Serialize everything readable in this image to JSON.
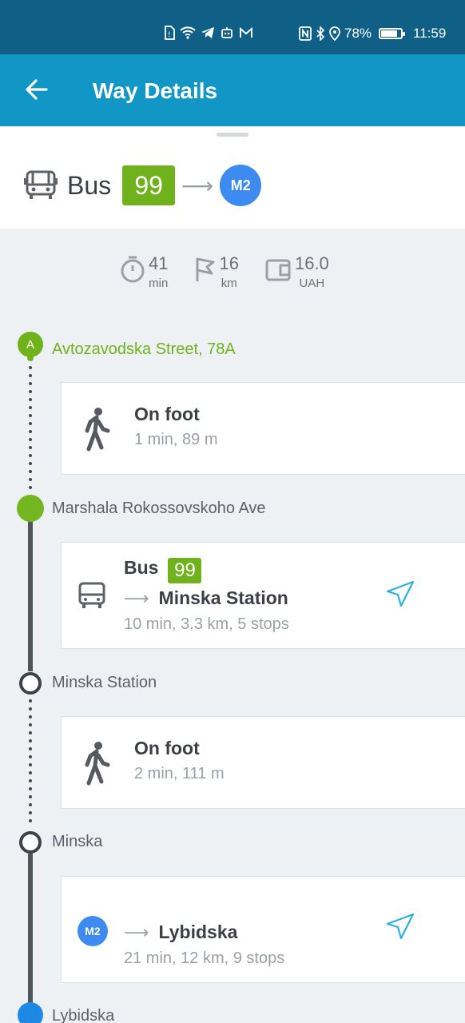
{
  "status_bar": {
    "battery": "78%",
    "time": "11:59",
    "icons_left": [
      "sim-icon",
      "wifi-icon",
      "telegram-icon",
      "robot-icon",
      "gmail-icon"
    ],
    "icons_right": [
      "nfc-icon",
      "bluetooth-icon",
      "location-icon"
    ]
  },
  "app_bar": {
    "title": "Way Details"
  },
  "route": {
    "mode": "Bus",
    "bus_number": "99",
    "metro_line": "M2"
  },
  "stats": {
    "time_value": "41",
    "time_unit": "min",
    "distance_value": "16",
    "distance_unit": "km",
    "cost_value": "16.0",
    "cost_unit": "UAH"
  },
  "stops": {
    "start_marker": "A",
    "start": "Avtozavodska Street, 78A",
    "stop2": "Marshala Rokossovskoho Ave",
    "stop3": "Minska Station",
    "stop4": "Minska",
    "stop5": "Lybidska"
  },
  "segments": {
    "walk1": {
      "title": "On foot",
      "details": "1 min, 89 m"
    },
    "bus": {
      "mode": "Bus",
      "number": "99",
      "destination": "Minska Station",
      "details": "10 min, 3.3 km, 5 stops"
    },
    "walk2": {
      "title": "On foot",
      "details": "2 min, 111 m"
    },
    "metro": {
      "line": "M2",
      "destination": "Lybidska",
      "details": "21 min, 12 km, 9 stops"
    }
  },
  "arrow_glyph": "⟶",
  "colors": {
    "app_bar": "#1196c6",
    "status_bar": "#0f5f87",
    "bus_green": "#6fb21c",
    "metro_blue": "#3d8bf0"
  }
}
